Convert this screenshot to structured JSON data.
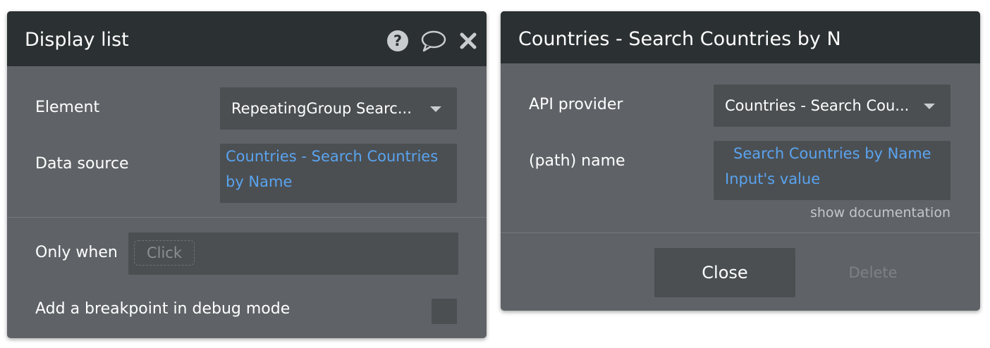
{
  "display_list_panel": {
    "title": "Display list",
    "header_icons": [
      "help-icon",
      "comment-icon",
      "close-icon"
    ],
    "element_label": "Element",
    "element_value": "RepeatingGroup Searc...",
    "data_source_label": "Data source",
    "data_source_line1": "Countries - Search Countries",
    "data_source_line2": "by Name",
    "only_when_label": "Only when",
    "only_when_placeholder": "Click",
    "breakpoint_label": "Add a breakpoint in debug mode"
  },
  "api_panel": {
    "title": "Countries - Search Countries by N",
    "api_provider_label": "API provider",
    "api_provider_value": "Countries - Search Cou...",
    "path_name_label": "(path) name",
    "path_name_line1": "Search Countries by Name",
    "path_name_line2": "Input's value",
    "show_documentation": "show documentation",
    "close_button": "Close",
    "delete_button": "Delete"
  },
  "colors": {
    "panel_body": "#5f6367",
    "panel_header": "#2b3032",
    "field_bg": "#4b4f52",
    "expression_blue": "#5aa3ef"
  }
}
